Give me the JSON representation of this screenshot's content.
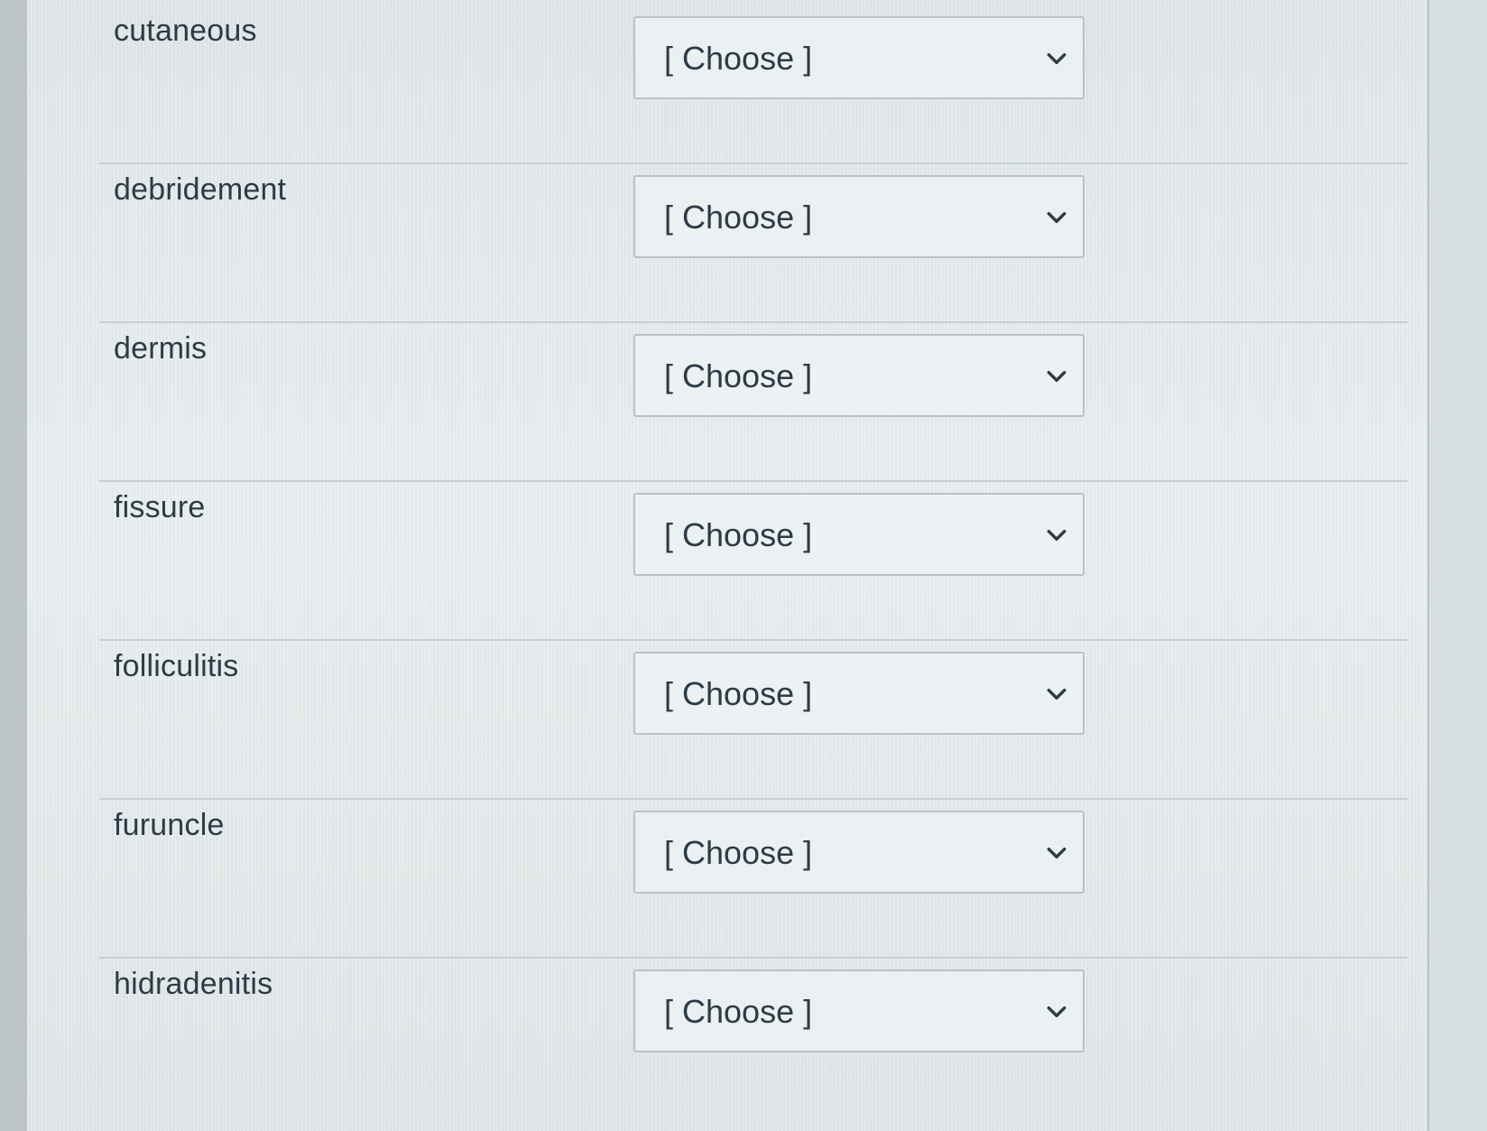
{
  "matching": {
    "rows": [
      {
        "term": "cutaneous",
        "selected": "[ Choose ]"
      },
      {
        "term": "debridement",
        "selected": "[ Choose ]"
      },
      {
        "term": "dermis",
        "selected": "[ Choose ]"
      },
      {
        "term": "fissure",
        "selected": "[ Choose ]"
      },
      {
        "term": "folliculitis",
        "selected": "[ Choose ]"
      },
      {
        "term": "furuncle",
        "selected": "[ Choose ]"
      },
      {
        "term": "hidradenitis",
        "selected": "[ Choose ]"
      }
    ]
  },
  "icons": {
    "dropdown": "chevron-down-icon"
  }
}
